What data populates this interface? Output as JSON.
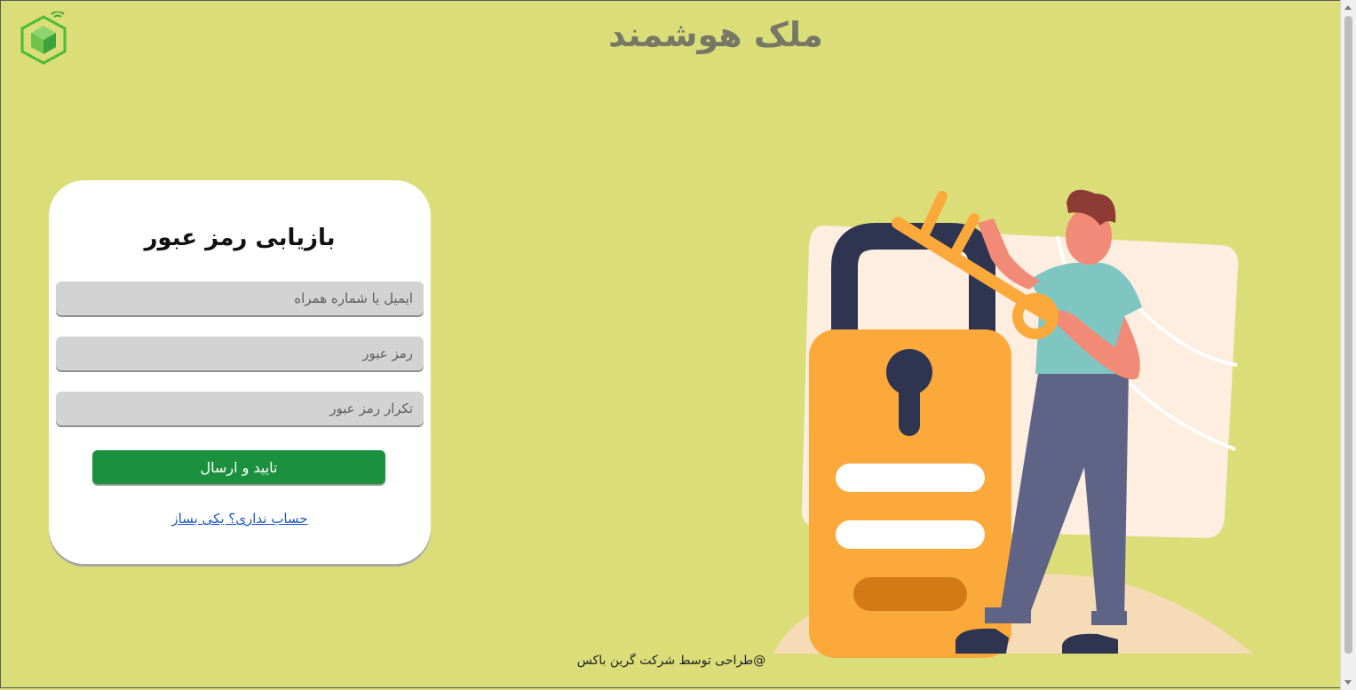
{
  "header": {
    "title": "ملک هوشمند"
  },
  "form": {
    "title": "بازیابی رمز عبور",
    "fields": {
      "contact_placeholder": "ایمیل یا شماره همراه",
      "password_placeholder": "رمز عبور",
      "confirm_placeholder": "تکرار رمز عبور"
    },
    "submit_label": "تایید و ارسال",
    "signup_link": "حساب نداری؟ یکی بساز"
  },
  "footer": {
    "credit": "@طراحی توسط شرکت گرین باکس"
  },
  "icons": {
    "logo": "smart-home-cube-logo",
    "illustration": "man-holding-key-padlock"
  },
  "colors": {
    "background": "#dbdd78",
    "accent_button": "#1b9140",
    "link": "#1a57c4",
    "lock": "#fca93c"
  }
}
